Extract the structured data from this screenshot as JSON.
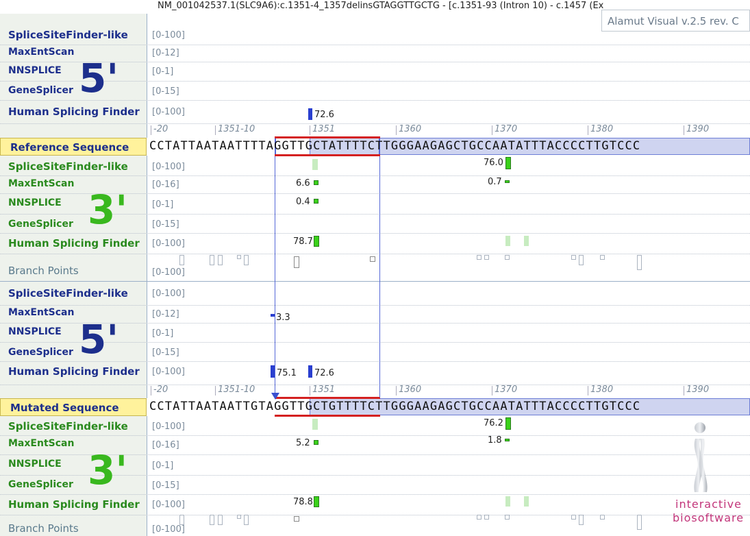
{
  "title": "NM_001042537.1(SLC9A6):c.1351-4_1357delinsGTAGGTTGCTG - [c.1351-93 (Intron 10) - c.1457 (Ex",
  "app_badge": "Alamut Visual v.2.5 rev. C",
  "ruler": {
    "t0": "-20",
    "t1": "1351-10",
    "t2": "1351",
    "t3": "1360",
    "t4": "1370",
    "t5": "1380",
    "t6": "1390"
  },
  "labels": {
    "ssf": "SpliceSiteFinder-like",
    "mes": "MaxEntScan",
    "nns": "NNSPLICE",
    "gs": "GeneSplicer",
    "hsf": "Human Splicing Finder",
    "bp": "Branch Points",
    "ref": "Reference Sequence",
    "mut": "Mutated Sequence",
    "five": "5'",
    "three": "3'"
  },
  "ranges": {
    "r100": "[0-100]",
    "r12": "[0-12]",
    "r1": "[0-1]",
    "r15": "[0-15]",
    "r16": "[0-16]"
  },
  "sequences": {
    "ref": "CCTATTAATAATTTTAGGTTGCTATTTTCTTGGGAAGAGCTGCCAATATTTACCCCTTGTCCC",
    "mut": "CCTATTAATAATTGTAGGTTGCTGTTTTCTTGGGAAGAGCTGCCAATATTTACCCCTTGTCCC"
  },
  "values": {
    "ref5_hsf": "72.6",
    "ref3_ssf": "76.0",
    "ref3_mes_a": "6.6",
    "ref3_mes_b": "0.7",
    "ref3_nns": "0.4",
    "ref3_hsf": "78.7",
    "mut5_mes": "3.3",
    "mut5_hsf_a": "75.1",
    "mut5_hsf_b": "72.6",
    "mut3_ssf": "76.2",
    "mut3_mes_a": "5.2",
    "mut3_mes_b": "1.8",
    "mut3_hsf": "78.8"
  },
  "logo": {
    "line1": "interactive",
    "line2": "biosoftware"
  },
  "colors": {
    "splice5": "#1d2f8c",
    "splice3": "#39b81e",
    "seq_label_bg": "#fff29c",
    "highlight": "#d42020",
    "logo_pink": "#c2357a"
  }
}
